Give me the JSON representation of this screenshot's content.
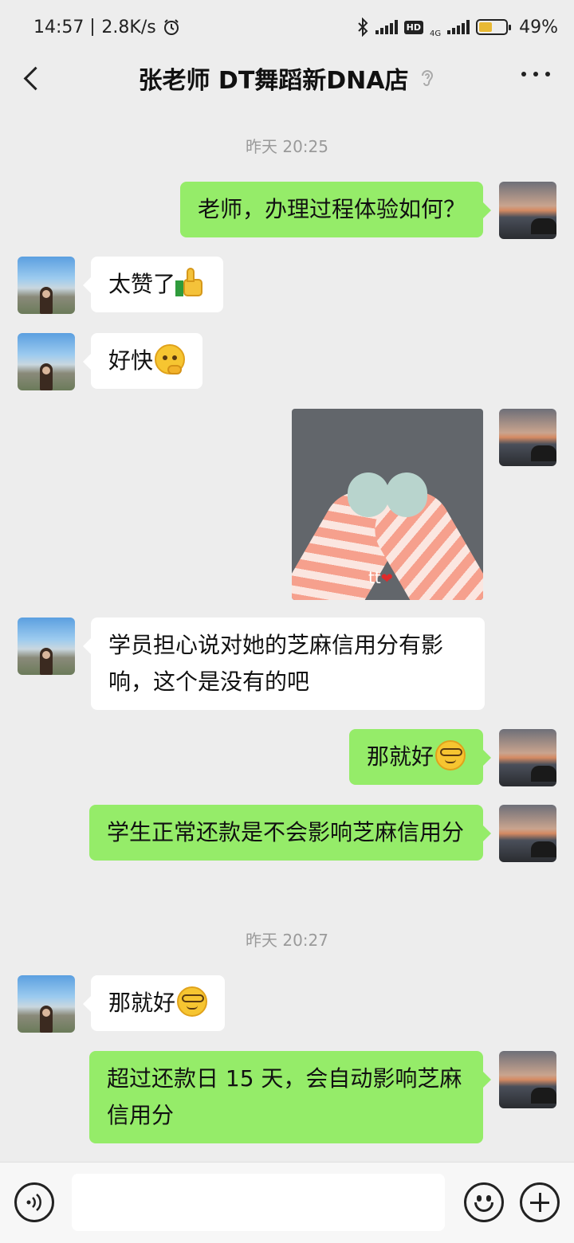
{
  "status_bar": {
    "time": "14:57",
    "net_speed": "2.8K/s",
    "network_4g": "4G",
    "hd": "HD",
    "battery_level": 0.49,
    "battery_text": "49%"
  },
  "header": {
    "title": "张老师  DT舞蹈新DNA店"
  },
  "messages": [
    {
      "type": "time",
      "text": "昨天 20:25"
    },
    {
      "side": "right",
      "text": "老师，办理过程体验如何？"
    },
    {
      "side": "left",
      "text": "太赞了",
      "emoji": "thumbs-up"
    },
    {
      "side": "left",
      "text": "好快",
      "emoji": "shy-face"
    },
    {
      "side": "right",
      "type": "image",
      "caption": "tt",
      "caption_emoji": "heart"
    },
    {
      "side": "left",
      "text": "学员担心说对她的芝麻信用分有影响，这个是没有的吧"
    },
    {
      "side": "right",
      "text": "那就好",
      "emoji": "glasses-face"
    },
    {
      "side": "right",
      "text": "学生正常还款是不会影响芝麻信用分"
    },
    {
      "type": "time",
      "text": "昨天 20:27"
    },
    {
      "side": "left",
      "text": "那就好",
      "emoji": "glasses-face"
    },
    {
      "side": "right",
      "text": "超过还款日 15 天，会自动影响芝麻信用分"
    }
  ],
  "input_bar": {
    "placeholder": "",
    "value": ""
  },
  "colors": {
    "background": "#ededed",
    "my_bubble": "#95ec69",
    "their_bubble": "#ffffff"
  }
}
